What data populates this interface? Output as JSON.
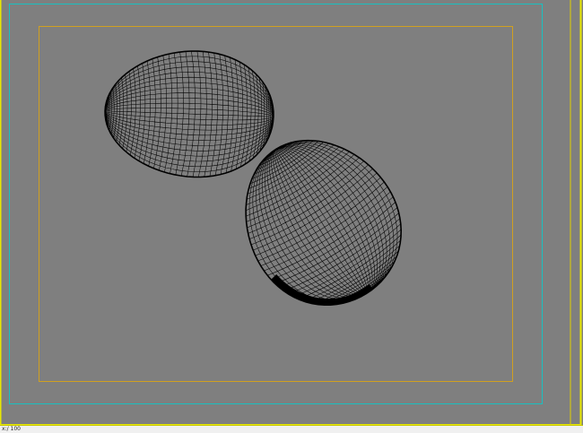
{
  "colors": {
    "background": "#7f7f7f",
    "safe_frame_outer": "#19c0c0",
    "safe_frame_inner": "#d0a020",
    "active_border": "#e8e800",
    "wire": "#000000"
  },
  "viewport": {
    "mode": "wireframe-perspective",
    "objects": [
      "egg-left",
      "egg-right"
    ]
  },
  "statusbar": {
    "coords_text": "x:/ 100"
  }
}
